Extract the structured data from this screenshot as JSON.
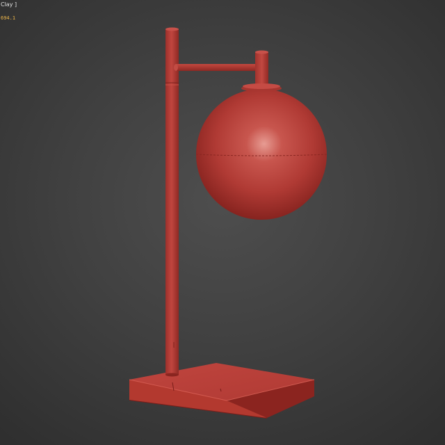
{
  "viewport": {
    "label": "Clay ]",
    "stat_readout": "694.1",
    "render_mode": "clay",
    "background_colors": [
      "#4e4e4e",
      "#2f2f2f"
    ]
  },
  "model": {
    "object": "desk-lamp",
    "parts": [
      "base-plate",
      "vertical-pole",
      "horizontal-arm",
      "arm-connector",
      "globe-shade"
    ],
    "clay_color": "#b8413b"
  }
}
